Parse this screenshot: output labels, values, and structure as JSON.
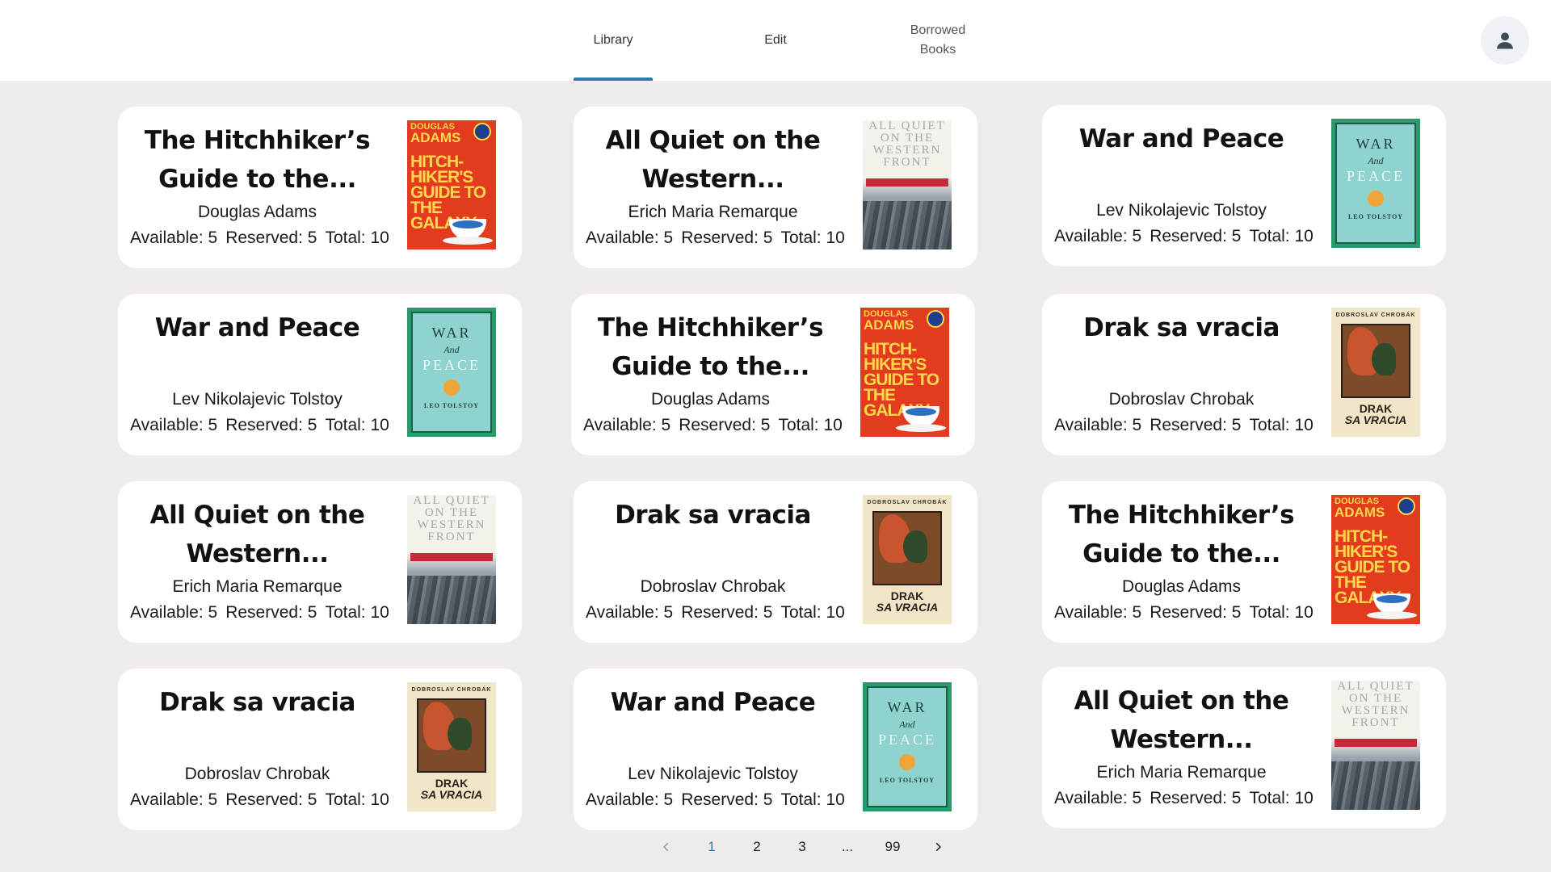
{
  "nav": {
    "tabs": [
      {
        "label": "Library"
      },
      {
        "label": "Edit"
      },
      {
        "label": "Borrowed\nBooks"
      }
    ]
  },
  "books": [
    {
      "title": "The Hitchhiker’s Guide to the...",
      "author": "Douglas Adams",
      "available": "Available: 5",
      "reserved": "Reserved: 5",
      "total": "Total: 10",
      "cover": "hitchhiker"
    },
    {
      "title": "All Quiet on the Western...",
      "author": "Erich Maria Remarque",
      "available": "Available: 5",
      "reserved": "Reserved: 5",
      "total": "Total: 10",
      "cover": "allquiet"
    },
    {
      "title": "War and Peace",
      "author": "Lev Nikolajevic Tolstoy",
      "available": "Available: 5",
      "reserved": "Reserved: 5",
      "total": "Total: 10",
      "cover": "warpeace"
    },
    {
      "title": "War and Peace",
      "author": "Lev Nikolajevic Tolstoy",
      "available": "Available: 5",
      "reserved": "Reserved: 5",
      "total": "Total: 10",
      "cover": "warpeace"
    },
    {
      "title": "The Hitchhiker’s Guide to the...",
      "author": "Douglas Adams",
      "available": "Available: 5",
      "reserved": "Reserved: 5",
      "total": "Total: 10",
      "cover": "hitchhiker"
    },
    {
      "title": "Drak sa vracia",
      "author": "Dobroslav Chrobak",
      "available": "Available: 5",
      "reserved": "Reserved: 5",
      "total": "Total: 10",
      "cover": "drak"
    },
    {
      "title": "All Quiet on the Western...",
      "author": "Erich Maria Remarque",
      "available": "Available: 5",
      "reserved": "Reserved: 5",
      "total": "Total: 10",
      "cover": "allquiet"
    },
    {
      "title": "Drak sa vracia",
      "author": "Dobroslav Chrobak",
      "available": "Available: 5",
      "reserved": "Reserved: 5",
      "total": "Total: 10",
      "cover": "drak"
    },
    {
      "title": "The Hitchhiker’s Guide to the...",
      "author": "Douglas Adams",
      "available": "Available: 5",
      "reserved": "Reserved: 5",
      "total": "Total: 10",
      "cover": "hitchhiker"
    },
    {
      "title": "Drak sa vracia",
      "author": "Dobroslav Chrobak",
      "available": "Available: 5",
      "reserved": "Reserved: 5",
      "total": "Total: 10",
      "cover": "drak"
    },
    {
      "title": "War and Peace",
      "author": "Lev Nikolajevic Tolstoy",
      "available": "Available: 5",
      "reserved": "Reserved: 5",
      "total": "Total: 10",
      "cover": "warpeace"
    },
    {
      "title": "All Quiet on the Western...",
      "author": "Erich Maria Remarque",
      "available": "Available: 5",
      "reserved": "Reserved: 5",
      "total": "Total: 10",
      "cover": "allquiet"
    }
  ],
  "covers": {
    "hitchhiker": {
      "line1": "DOUGLAS",
      "line2": "ADAMS",
      "title": "HITCH-HIKER'S GUIDE TO THE GALAXY"
    },
    "allquiet": {
      "title": "ALL QUIET ON THE WESTERN FRONT"
    },
    "warpeace": {
      "line1": "WAR",
      "line2": "And",
      "line3": "PEACE",
      "author": "LEO TOLSTOY"
    },
    "drak": {
      "author": "DOBROSLAV CHROBÁK",
      "line1": "DRAK",
      "line2": "SA VRACIA"
    }
  },
  "pagination": {
    "pages": [
      "1",
      "2",
      "3",
      "...",
      "99"
    ],
    "prev_icon": "chevron-left-icon",
    "next_icon": "chevron-right-icon",
    "active": "1"
  },
  "colors": {
    "accent": "#2b7fa6",
    "background": "#efeceb",
    "card": "#ffffff"
  }
}
